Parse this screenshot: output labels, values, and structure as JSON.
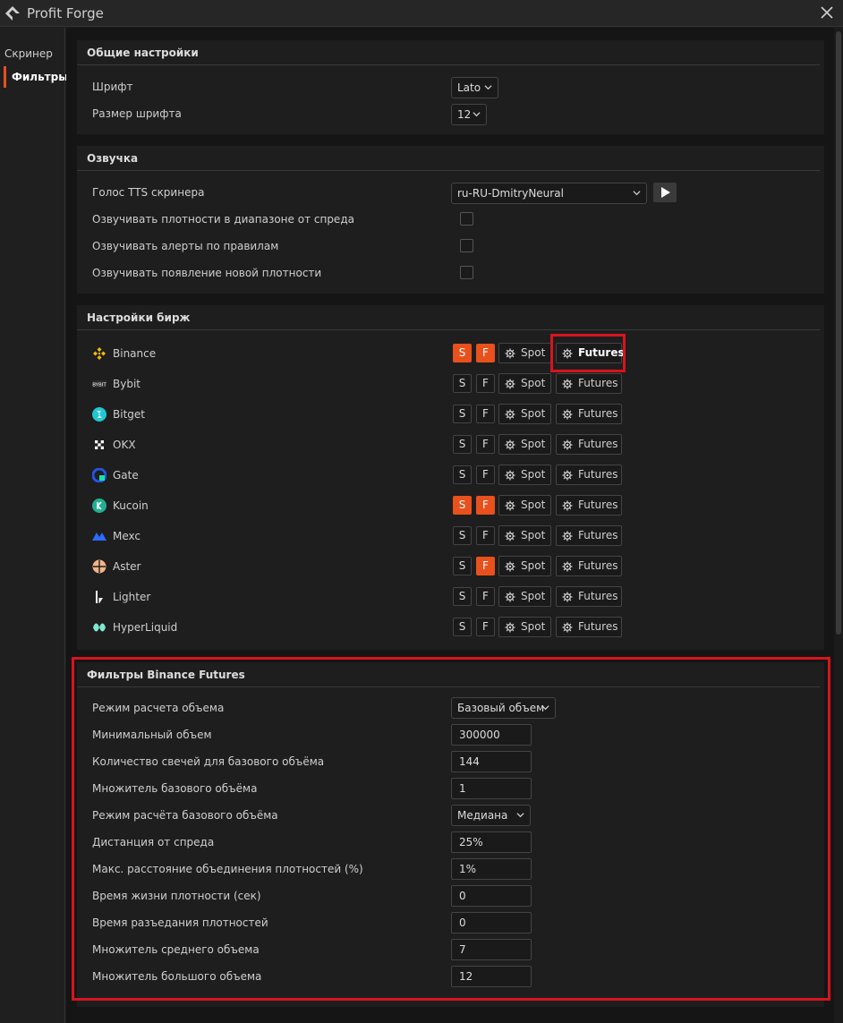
{
  "app": {
    "title": "Profit Forge"
  },
  "sidebar": {
    "items": [
      {
        "label": "Скринер"
      },
      {
        "label": "Фильтры"
      }
    ]
  },
  "general": {
    "title": "Общие настройки",
    "font_label": "Шрифт",
    "font_value": "Lato",
    "font_size_label": "Размер шрифта",
    "font_size_value": "12"
  },
  "voice": {
    "title": "Озвучка",
    "tts_label": "Голос TTS скринера",
    "tts_value": "ru-RU-DmitryNeural",
    "spread_density_label": "Озвучивать плотности в диапазоне от спреда",
    "alerts_label": "Озвучивать алерты по правилам",
    "new_density_label": "Озвучивать появление новой плотности"
  },
  "exchanges": {
    "title": "Настройки бирж",
    "spot_label": "Spot",
    "futures_label": "Futures",
    "s_label": "S",
    "f_label": "F",
    "list": [
      {
        "name": "Binance",
        "icon": "binance-icon",
        "s_on": true,
        "f_on": true
      },
      {
        "name": "Bybit",
        "icon": "bybit-icon",
        "s_on": false,
        "f_on": false
      },
      {
        "name": "Bitget",
        "icon": "bitget-icon",
        "s_on": false,
        "f_on": false
      },
      {
        "name": "OKX",
        "icon": "okx-icon",
        "s_on": false,
        "f_on": false
      },
      {
        "name": "Gate",
        "icon": "gate-icon",
        "s_on": false,
        "f_on": false
      },
      {
        "name": "Kucoin",
        "icon": "kucoin-icon",
        "s_on": true,
        "f_on": true
      },
      {
        "name": "Mexc",
        "icon": "mexc-icon",
        "s_on": false,
        "f_on": false
      },
      {
        "name": "Aster",
        "icon": "aster-icon",
        "s_on": false,
        "f_on": true
      },
      {
        "name": "Lighter",
        "icon": "lighter-icon",
        "s_on": false,
        "f_on": false
      },
      {
        "name": "HyperLiquid",
        "icon": "hyperliquid-icon",
        "s_on": false,
        "f_on": false
      }
    ]
  },
  "filters": {
    "title": "Фильтры Binance Futures",
    "volume_mode_label": "Режим расчета объема",
    "volume_mode_value": "Базовый объем",
    "min_volume_label": "Минимальный объем",
    "min_volume_value": "300000",
    "candles_label": "Количество свечей для базового объёма",
    "candles_value": "144",
    "base_mult_label": "Множитель базового объёма",
    "base_mult_value": "1",
    "base_mode_label": "Режим расчёта базового объёма",
    "base_mode_value": "Медиана",
    "spread_dist_label": "Дистанция от спреда",
    "spread_dist_value": "25%",
    "merge_dist_label": "Макс. расстояние объединения плотностей (%)",
    "merge_dist_value": "1%",
    "lifetime_label": "Время жизни плотности (сек)",
    "lifetime_value": "0",
    "corrosion_label": "Время разъедания плотностей",
    "corrosion_value": "0",
    "avg_mult_label": "Множитель среднего объема",
    "avg_mult_value": "7",
    "big_mult_label": "Множитель большого объема",
    "big_mult_value": "12"
  },
  "colors": {
    "accent": "#e8501c",
    "highlight": "#d7141e",
    "background": "#151515",
    "panel": "#1e1e1e"
  }
}
